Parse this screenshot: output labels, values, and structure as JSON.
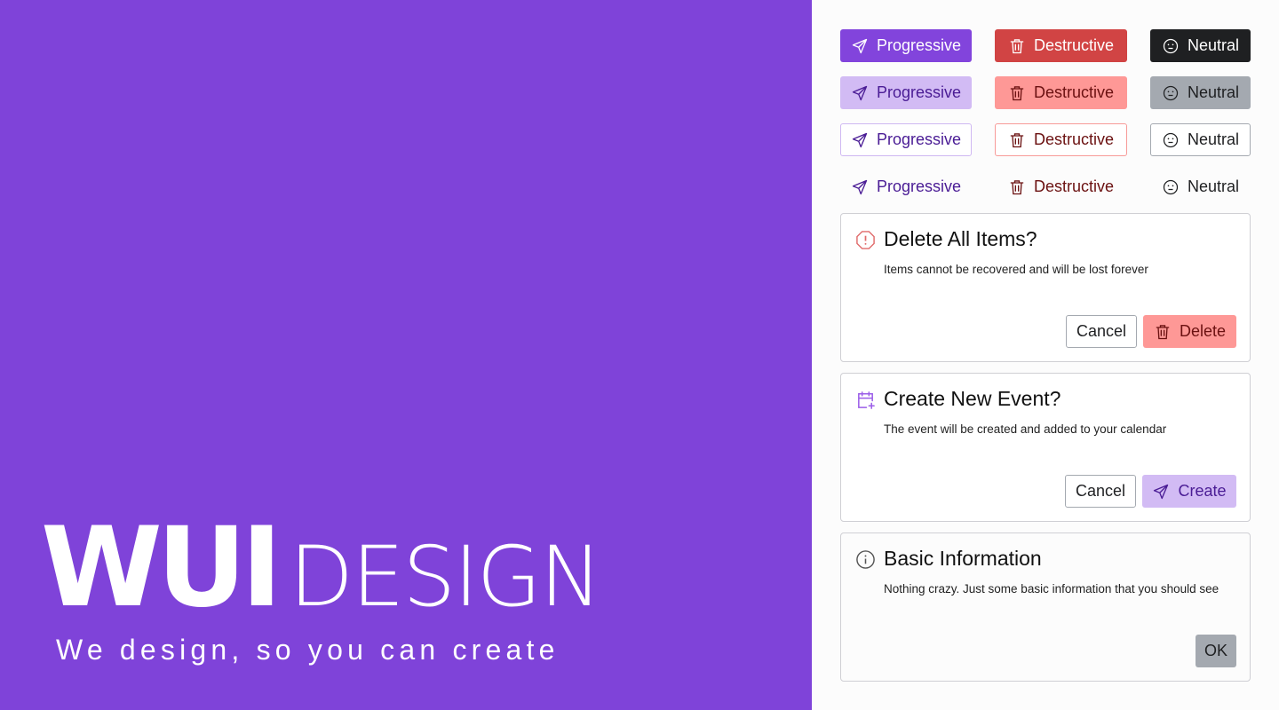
{
  "brand": {
    "bold": "WUI",
    "light": "DESIGN",
    "tagline": "We design, so you can create"
  },
  "colors": {
    "accent": "#7f43d9",
    "destructive": "#d14444",
    "neutral": "#1f2022",
    "progressive_soft": "#d2bbf4",
    "destructive_soft": "#fe9896",
    "neutral_soft": "#a4a9b0"
  },
  "button_rows": [
    {
      "style": "solid",
      "progressive": "Progressive",
      "destructive": "Destructive",
      "neutral": "Neutral"
    },
    {
      "style": "soft",
      "progressive": "Progressive",
      "destructive": "Destructive",
      "neutral": "Neutral"
    },
    {
      "style": "outline",
      "progressive": "Progressive",
      "destructive": "Destructive",
      "neutral": "Neutral"
    },
    {
      "style": "text",
      "progressive": "Progressive",
      "destructive": "Destructive",
      "neutral": "Neutral"
    }
  ],
  "icons": {
    "progressive": "send-icon",
    "destructive": "trash-icon",
    "neutral": "face-neutral-icon"
  },
  "dialogs": [
    {
      "icon": "alert-octagon-icon",
      "title": "Delete All Items?",
      "description": "Items cannot be recovered and will be lost forever",
      "cancel": "Cancel",
      "confirm": "Delete"
    },
    {
      "icon": "calendar-plus-icon",
      "title": "Create New Event?",
      "description": "The event will be created and added to your calendar",
      "cancel": "Cancel",
      "confirm": "Create"
    },
    {
      "icon": "info-icon",
      "title": "Basic Information",
      "description": "Nothing crazy. Just some basic information that you should see",
      "confirm": "OK"
    }
  ]
}
